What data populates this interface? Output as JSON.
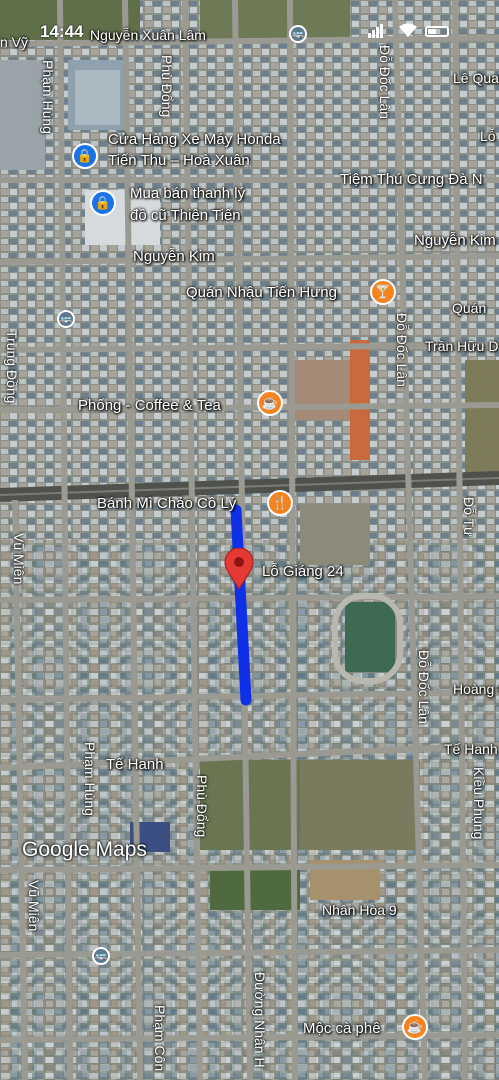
{
  "status_bar": {
    "time": "14:44"
  },
  "watermark": "Google Maps",
  "streets": {
    "nguyen_xuan_lam": "Nguyễn Xuân Lâm",
    "vy": "n Vỹ",
    "pham_hung_top": "Phạm Hùng",
    "phu_dong_top": "Phù Đổng",
    "do_doc_lan_top": "Đỗ Đốc Lân",
    "le_quang": "Lê Quan",
    "lo": "Lỗ",
    "nguyen_kim_left": "Nguyễn Kim",
    "nguyen_kim_right": "Nguyễn Kim",
    "tran_huu": "Trần Hữu D",
    "do_doc_lan_mid": "Đỗ Đốc Lân",
    "trung_dong": "Trung Đồng",
    "vu_mien_mid": "Vũ Miên",
    "do_tu": "Đỗ Tư",
    "lo_giang": "Lỗ Giáng 24",
    "do_doc_lan_low": "Đỗ Đốc Lân",
    "hoang_c": "Hoàng C",
    "te_hanh_right": "Tế Hanh",
    "te_hanh_left": "Tế Hanh",
    "pham_hung_low": "Phạm Hùng",
    "phu_dong_low": "Phù Đổng",
    "kieu_phung": "Kiều Phụng",
    "vu_mien_low": "Vũ Miên",
    "nhan_hoa": "Nhân Hòa 9",
    "pham_con": "Phạm Côn",
    "duong_nhan": "Đường Nhân H"
  },
  "pois": {
    "honda": "Cửa Hàng Xe Máy Honda\nTiến Thu – Hoà Xuân",
    "honda_l1": "Cửa Hàng Xe Máy Honda",
    "honda_l2": "Tiến Thu – Hoà Xuân",
    "thanh_ly_l1": "Mua bán thanh lý",
    "thanh_ly_l2": "đồ cũ Thiên Tiến",
    "tiem_thu_cung": "Tiệm Thú Cưng Đà N",
    "quan_nhau": "Quán Nhậu Tiến Hưng",
    "quan": "Quán",
    "phong_coffee": "Phống - Coffee & Tea",
    "banh_mi": "Bánh Mì Chảo Cô Lý",
    "moc_ca_phe": "Mộc cà phê"
  },
  "icons": {
    "shop": "shopping-bag-icon",
    "bar": "cocktail-icon",
    "cafe": "coffee-cup-icon",
    "restaurant": "fork-knife-icon",
    "bus": "bus-stop-icon",
    "pin": "location-pin-icon"
  },
  "colors": {
    "route": "#1030e8",
    "pin": "#e53935",
    "shop": "#1a73e8",
    "food": "#f5841f"
  }
}
